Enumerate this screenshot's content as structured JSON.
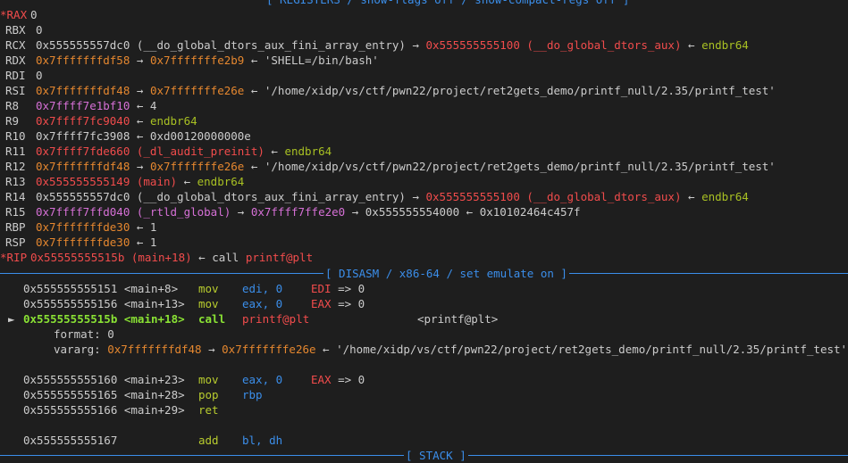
{
  "registers_header": "[ REGISTERS / show-flags off / show-compact-regs off ]",
  "registers": [
    {
      "name": "*RAX",
      "changed": true,
      "parts": [
        {
          "t": "0",
          "c": "white"
        }
      ]
    },
    {
      "name": "RBX",
      "changed": false,
      "parts": [
        {
          "t": "0",
          "c": "white"
        }
      ]
    },
    {
      "name": "RCX",
      "changed": false,
      "parts": [
        {
          "t": "0x555555557dc0 (__do_global_dtors_aux_fini_array_entry) ",
          "c": "white"
        },
        {
          "t": "→ ",
          "c": "white"
        },
        {
          "t": "0x555555555100 (__do_global_dtors_aux)",
          "c": "red"
        },
        {
          "t": " ← ",
          "c": "white"
        },
        {
          "t": "endbr64",
          "c": "green"
        }
      ]
    },
    {
      "name": "RDX",
      "changed": false,
      "parts": [
        {
          "t": "0x7fffffffdf58",
          "c": "orange"
        },
        {
          "t": " → ",
          "c": "white"
        },
        {
          "t": "0x7fffffffe2b9",
          "c": "orange"
        },
        {
          "t": " ← 'SHELL=/bin/bash'",
          "c": "white"
        }
      ]
    },
    {
      "name": "RDI",
      "changed": false,
      "parts": [
        {
          "t": "0",
          "c": "white"
        }
      ]
    },
    {
      "name": "RSI",
      "changed": false,
      "parts": [
        {
          "t": "0x7fffffffdf48",
          "c": "orange"
        },
        {
          "t": " → ",
          "c": "white"
        },
        {
          "t": "0x7fffffffe26e",
          "c": "orange"
        },
        {
          "t": " ← '/home/xidp/vs/ctf/pwn22/project/ret2gets_demo/printf_null/2.35/printf_test'",
          "c": "white"
        }
      ]
    },
    {
      "name": "R8",
      "changed": false,
      "parts": [
        {
          "t": "0x7ffff7e1bf10",
          "c": "magenta"
        },
        {
          "t": " ← 4",
          "c": "white"
        }
      ]
    },
    {
      "name": "R9",
      "changed": false,
      "parts": [
        {
          "t": "0x7ffff7fc9040",
          "c": "red"
        },
        {
          "t": " ← ",
          "c": "white"
        },
        {
          "t": "endbr64",
          "c": "green"
        }
      ]
    },
    {
      "name": "R10",
      "changed": false,
      "parts": [
        {
          "t": "0x7ffff7fc3908 ← 0xd00120000000e",
          "c": "white"
        }
      ]
    },
    {
      "name": "R11",
      "changed": false,
      "parts": [
        {
          "t": "0x7ffff7fde660 (_dl_audit_preinit)",
          "c": "red"
        },
        {
          "t": " ← ",
          "c": "white"
        },
        {
          "t": "endbr64",
          "c": "green"
        }
      ]
    },
    {
      "name": "R12",
      "changed": false,
      "parts": [
        {
          "t": "0x7fffffffdf48",
          "c": "orange"
        },
        {
          "t": " → ",
          "c": "white"
        },
        {
          "t": "0x7fffffffe26e",
          "c": "orange"
        },
        {
          "t": " ← '/home/xidp/vs/ctf/pwn22/project/ret2gets_demo/printf_null/2.35/printf_test'",
          "c": "white"
        }
      ]
    },
    {
      "name": "R13",
      "changed": false,
      "parts": [
        {
          "t": "0x555555555149 (main)",
          "c": "red"
        },
        {
          "t": " ← ",
          "c": "white"
        },
        {
          "t": "endbr64",
          "c": "green"
        }
      ]
    },
    {
      "name": "R14",
      "changed": false,
      "parts": [
        {
          "t": "0x555555557dc0 (__do_global_dtors_aux_fini_array_entry) ",
          "c": "white"
        },
        {
          "t": "→ ",
          "c": "white"
        },
        {
          "t": "0x555555555100 (__do_global_dtors_aux)",
          "c": "red"
        },
        {
          "t": " ← ",
          "c": "white"
        },
        {
          "t": "endbr64",
          "c": "green"
        }
      ]
    },
    {
      "name": "R15",
      "changed": false,
      "parts": [
        {
          "t": "0x7ffff7ffd040 (_rtld_global)",
          "c": "magenta"
        },
        {
          "t": " → ",
          "c": "white"
        },
        {
          "t": "0x7ffff7ffe2e0",
          "c": "magenta"
        },
        {
          "t": " → 0x555555554000 ← 0x10102464c457f",
          "c": "white"
        }
      ]
    },
    {
      "name": "RBP",
      "changed": false,
      "parts": [
        {
          "t": "0x7fffffffde30",
          "c": "orange"
        },
        {
          "t": " ← 1",
          "c": "white"
        }
      ]
    },
    {
      "name": "RSP",
      "changed": false,
      "parts": [
        {
          "t": "0x7fffffffde30",
          "c": "orange"
        },
        {
          "t": " ← 1",
          "c": "white"
        }
      ]
    },
    {
      "name": "*RIP",
      "changed": true,
      "parts": [
        {
          "t": "0x55555555515b (main+18)",
          "c": "red"
        },
        {
          "t": " ← call ",
          "c": "white"
        },
        {
          "t": "printf@plt",
          "c": "red"
        }
      ]
    }
  ],
  "disasm_header": "[ DISASM / x86-64 / set emulate on ]",
  "disasm": [
    {
      "addr": "0x555555555151 <main+8>",
      "mn": "mov",
      "op": "edi, 0",
      "comment": "EDI => 0",
      "current": false
    },
    {
      "addr": "0x555555555156 <main+13>",
      "mn": "mov",
      "op": "eax, 0",
      "comment": "EAX => 0",
      "current": false
    },
    {
      "addr": "0x55555555515b <main+18>",
      "mn": "call",
      "op": "printf@plt",
      "comment": "<printf@plt>",
      "current": true,
      "marker": "►"
    }
  ],
  "call_args": [
    {
      "text": "format: 0"
    },
    {
      "label": "vararg: ",
      "parts": [
        {
          "t": "0x7fffffffdf48",
          "c": "orange"
        },
        {
          "t": " → ",
          "c": "white"
        },
        {
          "t": "0x7fffffffe26e",
          "c": "orange"
        },
        {
          "t": " ← '/home/xidp/vs/ctf/pwn22/project/ret2gets_demo/printf_null/2.35/printf_test'",
          "c": "white"
        }
      ]
    }
  ],
  "disasm2": [
    {
      "addr": "0x555555555160 <main+23>",
      "mn": "mov",
      "op": "eax, 0",
      "comment": "EAX => 0"
    },
    {
      "addr": "0x555555555165 <main+28>",
      "mn": "pop",
      "op": "rbp",
      "comment": ""
    },
    {
      "addr": "0x555555555166 <main+29>",
      "mn": "ret",
      "op": "",
      "comment": ""
    }
  ],
  "disasm3": [
    {
      "addr": "0x555555555167",
      "mn": "add",
      "op": "bl, dh",
      "comment": ""
    }
  ],
  "stack_header": "[ STACK ]"
}
